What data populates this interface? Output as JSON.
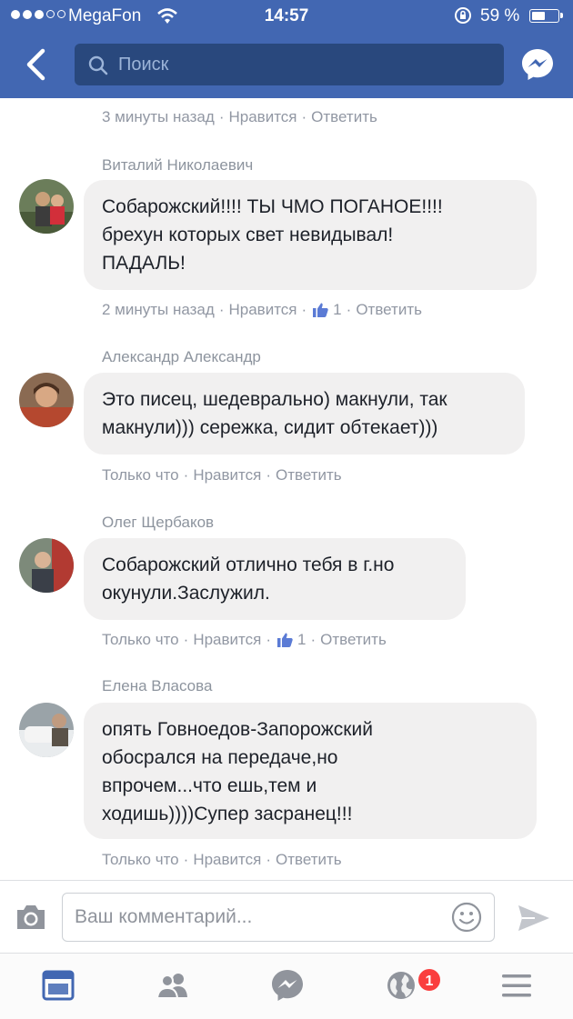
{
  "status_bar": {
    "carrier": "MegaFon",
    "time": "14:57",
    "battery": "59 %",
    "battery_level": 0.59
  },
  "header": {
    "search_placeholder": "Поиск"
  },
  "actions": {
    "like": "Нравится",
    "reply": "Ответить"
  },
  "first_meta": {
    "time": "3 минуты назад"
  },
  "comments": [
    {
      "author": "Виталий Николаевич",
      "lines": [
        "Собарожский!!!! ТЫ ЧМО ПОГАНОЕ!!!!",
        "брехун которых свет невидывал!",
        "ПАДАЛЬ!"
      ],
      "time": "2 минуты назад",
      "likes": "1"
    },
    {
      "author": "Александр Александр",
      "lines": [
        "Это писец, шедеврально) макнули, так",
        "макнули))) сережка, сидит обтекает)))"
      ],
      "time": "Только что",
      "likes": null
    },
    {
      "author": "Олег Щербаков",
      "lines": [
        "Собарожский отлично тебя в г.но",
        "окунули.Заслужил."
      ],
      "time": "Только что",
      "likes": "1"
    },
    {
      "author": "Елена Власова",
      "lines": [
        "опять Говноедов-Запорожский",
        "обосрался на передаче,но",
        "впрочем...что ешь,тем и",
        "ходишь))))Супер засранец!!!"
      ],
      "time": "Только что",
      "likes": null
    }
  ],
  "composer": {
    "placeholder": "Ваш комментарий..."
  },
  "tab_bar": {
    "notifications_badge": "1"
  },
  "colors": {
    "brand": "#4267b2",
    "bubble": "#f1f0f0",
    "meta_text": "#9197a3",
    "badge": "#fa3e3e"
  }
}
